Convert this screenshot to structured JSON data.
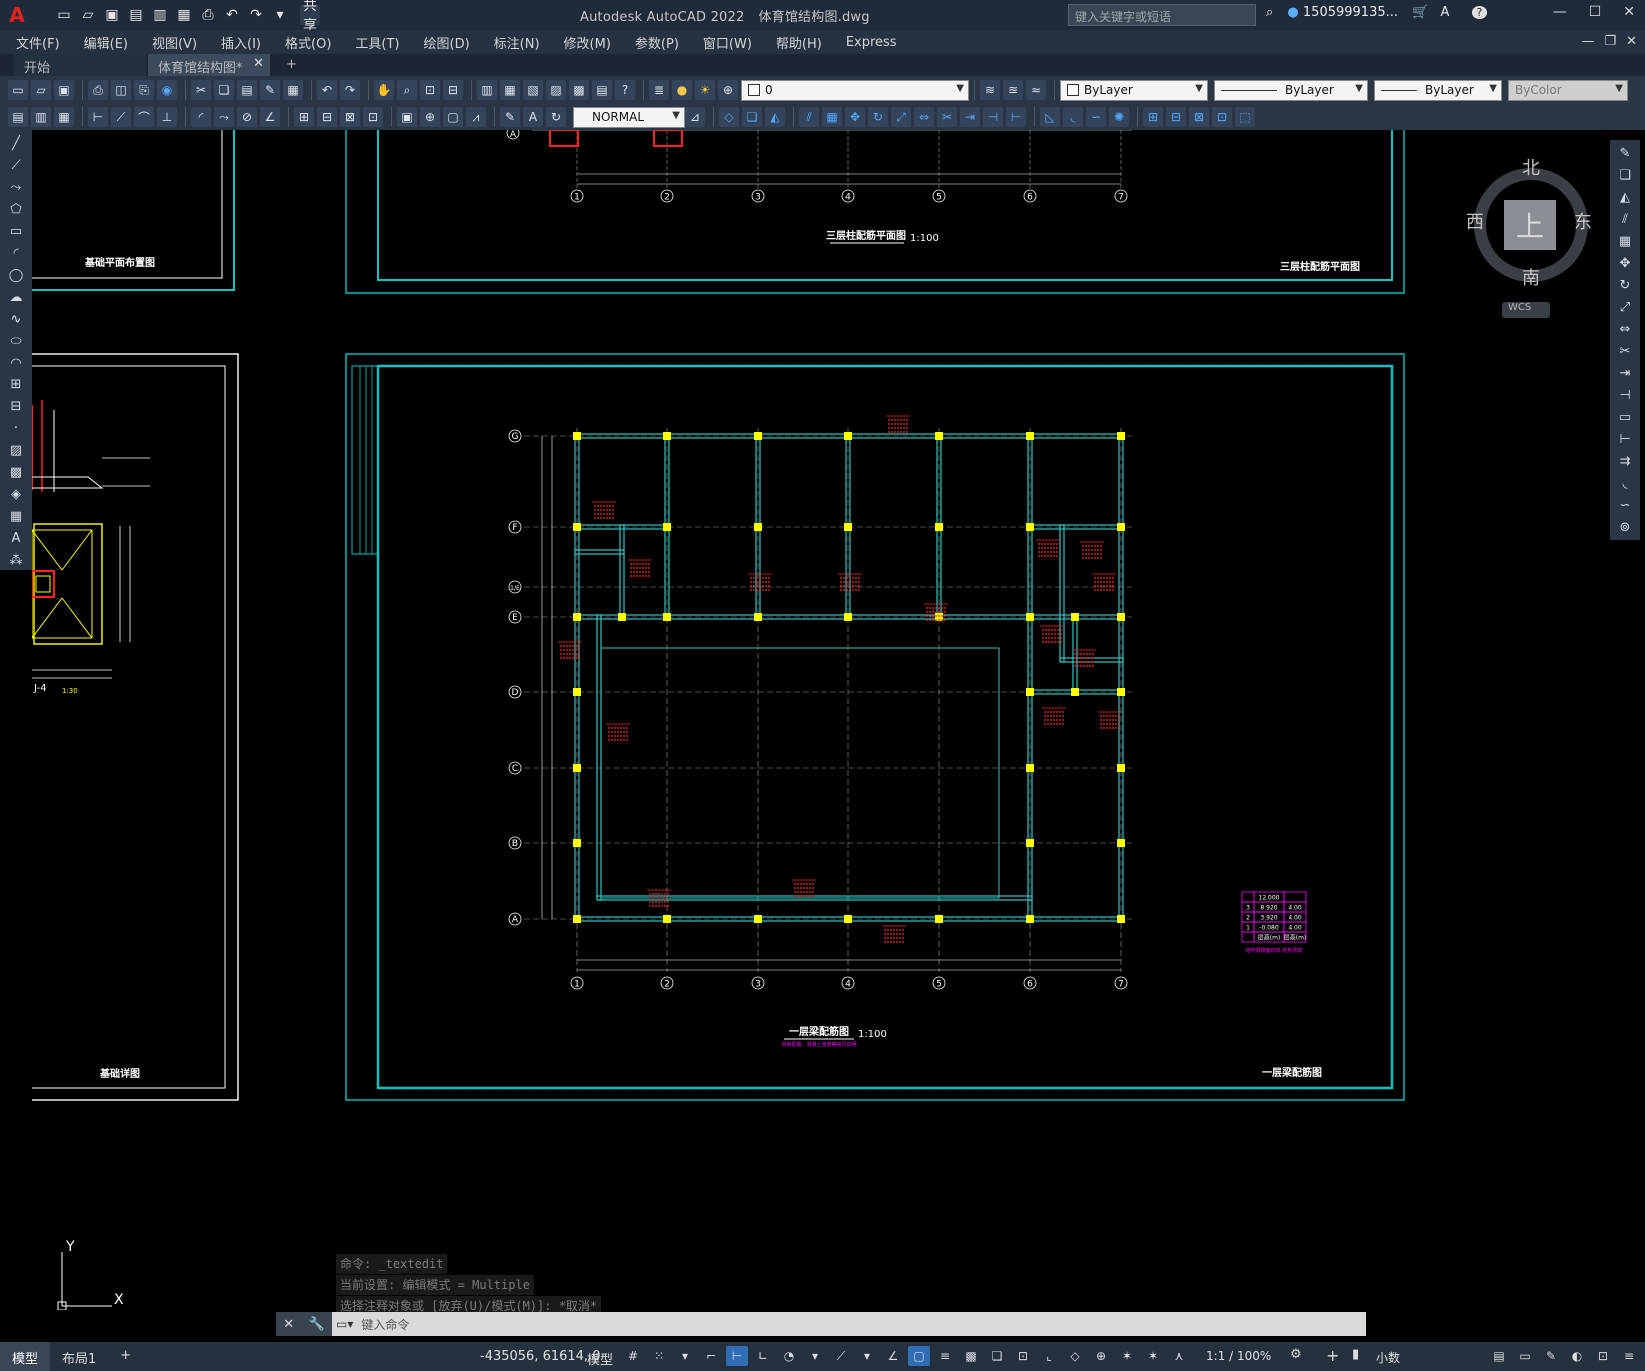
{
  "titlebar": {
    "app_logo": "A",
    "share_label": "共享",
    "app_title": "Autodesk AutoCAD 2022",
    "file_title": "体育馆结构图.dwg",
    "search_placeholder": "键入关键字或短语",
    "user": "1505999135...",
    "help": "?"
  },
  "menubar": {
    "items": [
      "文件(F)",
      "编辑(E)",
      "视图(V)",
      "插入(I)",
      "格式(O)",
      "工具(T)",
      "绘图(D)",
      "标注(N)",
      "修改(M)",
      "参数(P)",
      "窗口(W)",
      "帮助(H)",
      "Express"
    ]
  },
  "tabs": {
    "start": "开始",
    "doc": "体育馆结构图*",
    "close": "✕",
    "add": "+"
  },
  "properties": {
    "layer_value": "0",
    "color_value": "ByLayer",
    "linetype_value": "ByLayer",
    "lineweight_value": "ByLayer",
    "plotstyle_value": "ByColor",
    "dimstyle_value": "NORMAL"
  },
  "viewcube": {
    "north": "北",
    "south": "南",
    "east": "东",
    "west": "西",
    "face": "上",
    "wcs": "WCS"
  },
  "drawing": {
    "top_plan_title": "三层柱配筋平面图",
    "top_plan_scale": "1:100",
    "top_sheet_label": "三层柱配筋平面图",
    "left_top_sheet_label": "基础平面布置图",
    "left_bottom_sheet_label": "基础详图",
    "main_plan_title": "一层梁配筋图",
    "main_plan_scale": "1:100",
    "main_plan_note": "梁板配筋，混凝土强度等级见说明",
    "main_sheet_label": "一层梁配筋图",
    "detail_label": "J-4",
    "detail_scale": "1:30",
    "axes_x": [
      "1",
      "2",
      "3",
      "4",
      "5",
      "6",
      "7"
    ],
    "axes_y": [
      "G",
      "F",
      "1/E",
      "E",
      "D",
      "C",
      "B",
      "A"
    ],
    "level_table": [
      [
        "",
        "12.000",
        ""
      ],
      [
        "3",
        "8.920",
        "4.00"
      ],
      [
        "2",
        "3.920",
        "4.00"
      ],
      [
        "1",
        "-0.080",
        "4.00"
      ],
      [
        "",
        "层高(m)",
        "层高(m)"
      ]
    ],
    "level_table_caption": "结构层楼面标高 结构层高"
  },
  "command": {
    "history": [
      "命令: _textedit",
      "当前设置: 编辑模式 = Multiple",
      "选择注释对象或 [放弃(U)/模式(M)]: *取消*"
    ],
    "placeholder": "键入命令"
  },
  "status": {
    "layout_tabs": [
      "模型",
      "布局1"
    ],
    "add_layout": "+",
    "coords": "-435056, 61614, 0",
    "space": "模型",
    "scale": "1:1 / 100%",
    "units": "小数"
  },
  "colors": {
    "cyan": "#00c8c8",
    "beam": "#2fc4c0",
    "column": "#ffff00",
    "rebar_red": "#ff2020",
    "magenta": "#ff00ff",
    "white": "#ffffff",
    "grid": "#9a9a9a"
  }
}
